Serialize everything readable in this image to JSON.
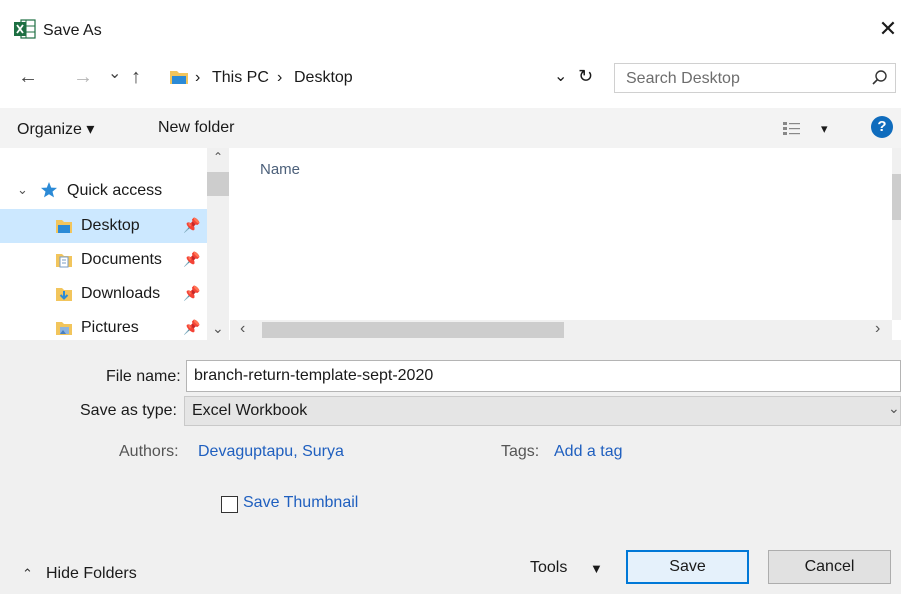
{
  "window": {
    "title": "Save As",
    "app_icon": "excel-icon",
    "close_glyph": "✕"
  },
  "nav": {
    "back_glyph": "←",
    "forward_glyph": "→",
    "recent_glyph": "⌄",
    "up_glyph": "↑",
    "breadcrumb": [
      "This PC",
      "Desktop"
    ],
    "sep_glyph": "›",
    "refresh_glyph": "↻",
    "dropdown_glyph": "⌄",
    "search_placeholder": "Search Desktop"
  },
  "toolbar": {
    "organize_label": "Organize ▾",
    "new_folder_label": "New folder",
    "view_glyph": "▾",
    "help_glyph": "?"
  },
  "sidebar": {
    "quick_access": "Quick access",
    "items": [
      {
        "label": "Desktop",
        "icon": "desktop-folder-icon",
        "selected": true
      },
      {
        "label": "Documents",
        "icon": "documents-folder-icon",
        "selected": false
      },
      {
        "label": "Downloads",
        "icon": "downloads-folder-icon",
        "selected": false
      },
      {
        "label": "Pictures",
        "icon": "pictures-folder-icon",
        "selected": false
      }
    ]
  },
  "file_list": {
    "column_name": "Name",
    "scroll_left_glyph": "‹",
    "scroll_right_glyph": "›"
  },
  "form": {
    "file_name_label": "File name:",
    "file_name_value": "branch-return-template-sept-2020",
    "save_type_label": "Save as type:",
    "save_type_value": "Excel Workbook",
    "authors_label": "Authors:",
    "authors_value": "Devaguptapu, Surya",
    "tags_label": "Tags:",
    "tags_value": "Add a tag",
    "save_thumbnail_label": "Save Thumbnail"
  },
  "footer": {
    "hide_folders_label": "Hide Folders",
    "tools_label": "Tools",
    "save_label": "Save",
    "cancel_label": "Cancel"
  },
  "colors": {
    "accent": "#0078d7",
    "selection": "#cce8ff",
    "link": "#1f5fbf",
    "excel_green": "#1d6f42"
  }
}
